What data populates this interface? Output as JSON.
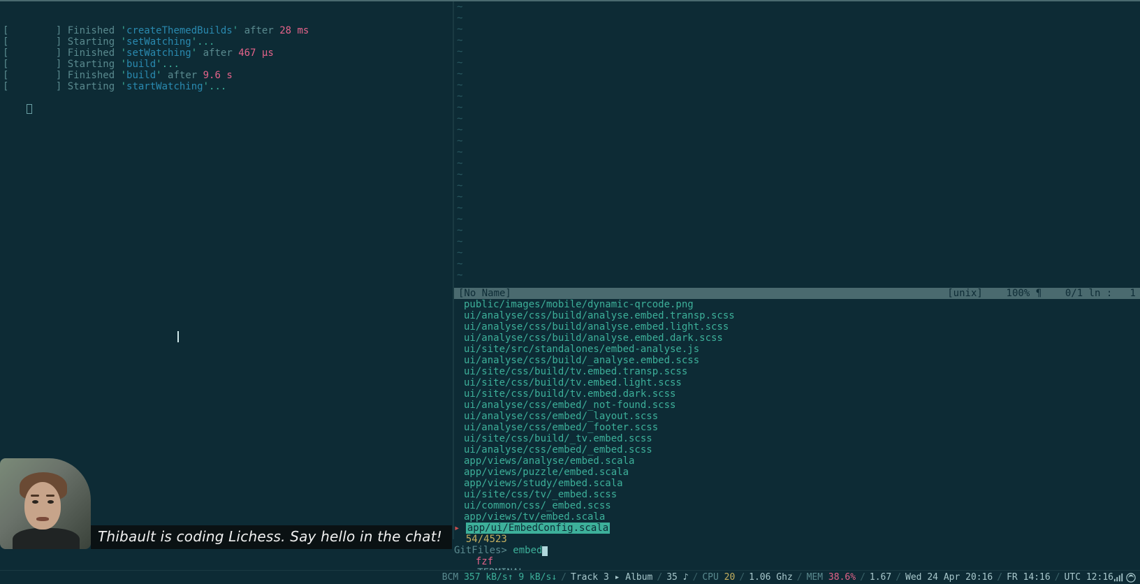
{
  "log": [
    {
      "prefix": "[        ] ",
      "verb": "Finished",
      "q1": "'",
      "task": "createThemedBuilds",
      "q2": "'",
      "after": " after ",
      "time": "28 ms"
    },
    {
      "prefix": "[        ] ",
      "verb": "Starting",
      "q1": "'",
      "task": "setWatching",
      "q2": "'...",
      "after": "",
      "time": ""
    },
    {
      "prefix": "[        ] ",
      "verb": "Finished",
      "q1": "'",
      "task": "setWatching",
      "q2": "'",
      "after": " after ",
      "time": "467 μs"
    },
    {
      "prefix": "[        ] ",
      "verb": "Starting",
      "q1": "'",
      "task": "build",
      "q2": "'...",
      "after": "",
      "time": ""
    },
    {
      "prefix": "[        ] ",
      "verb": "Finished",
      "q1": "'",
      "task": "build",
      "q2": "'",
      "after": " after ",
      "time": "9.6 s"
    },
    {
      "prefix": "[        ] ",
      "verb": "Starting",
      "q1": "'",
      "task": "startWatching",
      "q2": "'...",
      "after": "",
      "time": ""
    }
  ],
  "vimstatus": {
    "name": "[No Name]",
    "enc": "[unix]",
    "pct": "100% ¶",
    "pos": "0/1 ln :   1"
  },
  "fzf": {
    "files": [
      "public/images/mobile/dynamic-qrcode.png",
      "ui/analyse/css/build/analyse.embed.transp.scss",
      "ui/analyse/css/build/analyse.embed.light.scss",
      "ui/analyse/css/build/analyse.embed.dark.scss",
      "ui/site/src/standalones/embed-analyse.js",
      "ui/analyse/css/build/_analyse.embed.scss",
      "ui/site/css/build/tv.embed.transp.scss",
      "ui/site/css/build/tv.embed.light.scss",
      "ui/site/css/build/tv.embed.dark.scss",
      "ui/analyse/css/embed/_not-found.scss",
      "ui/analyse/css/embed/_layout.scss",
      "ui/analyse/css/embed/_footer.scss",
      "ui/site/css/build/_tv.embed.scss",
      "ui/analyse/css/embed/_embed.scss",
      "app/views/analyse/embed.scala",
      "app/views/puzzle/embed.scala",
      "app/views/study/embed.scala",
      "ui/site/css/tv/_embed.scss",
      "ui/common/css/_embed.scss",
      "app/views/tv/embed.scala"
    ],
    "selected": "app/ui/EmbedConfig.scala",
    "count": "54/4523",
    "prompt_label": "GitFiles> ",
    "prompt_value": "embed",
    "title": "fzf",
    "mode": "-- TERMINAL --"
  },
  "caption": "Thibault is coding Lichess. Say hello in the chat!",
  "status": {
    "net_label": "BCM ",
    "net_up": "357 kB/s↑ ",
    "net_down": "9 kB/s↓",
    "track": "Track 3 ▸ Album",
    "track_extra": "35 ♪",
    "cpu_label": "CPU ",
    "cpu_value": "20",
    "ghz": "1.06 Ghz",
    "mem_label": "MEM ",
    "mem_value": "38.6%",
    "load": "1.67",
    "date": "Wed 24 Apr 20:16",
    "tz1": "FR 14:16",
    "tz2": "UTC 12:16"
  }
}
